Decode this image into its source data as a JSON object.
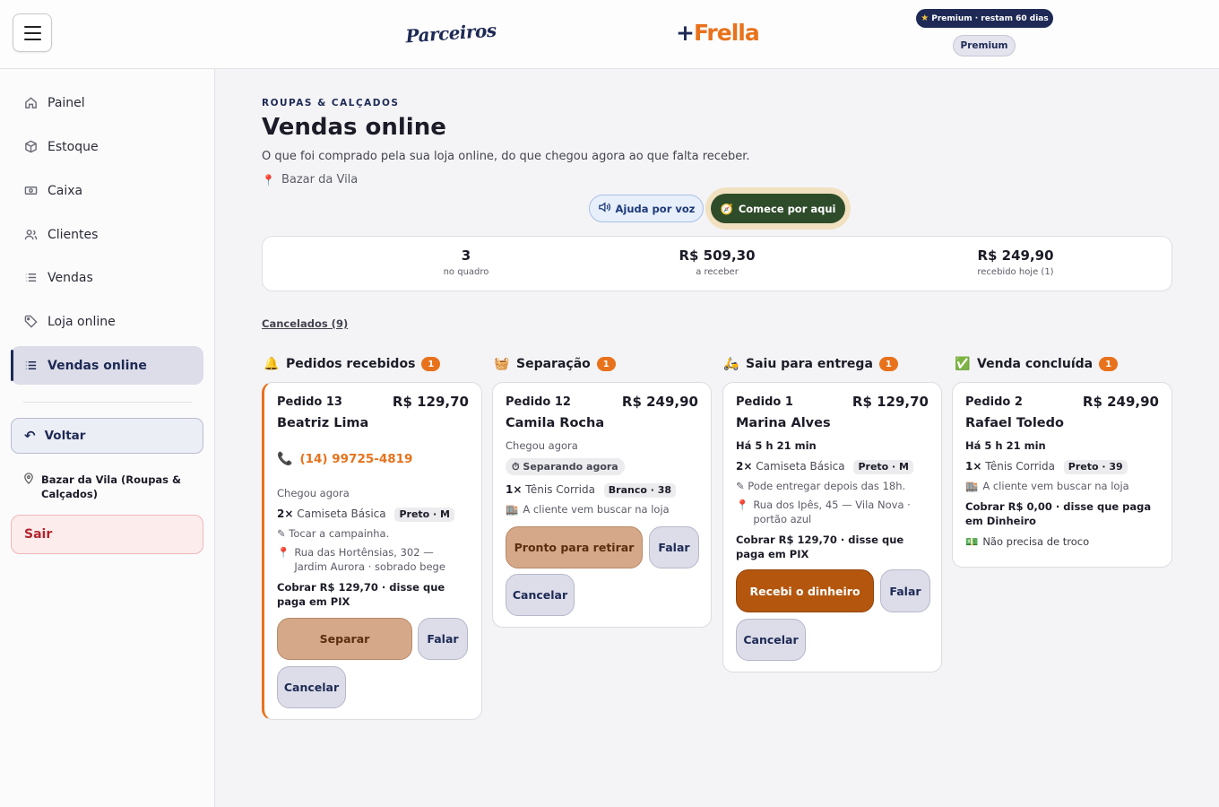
{
  "header": {
    "logo_parceiros": "Parceiros",
    "logo_frella_plus": "+",
    "logo_frella_name": "Frella",
    "premium_pill": "Premium · restam 60 dias",
    "premium_badge": "Premium"
  },
  "sidebar": {
    "items": [
      {
        "label": "Painel",
        "icon": "home-icon"
      },
      {
        "label": "Estoque",
        "icon": "box-icon"
      },
      {
        "label": "Caixa",
        "icon": "cash-icon"
      },
      {
        "label": "Clientes",
        "icon": "users-icon"
      },
      {
        "label": "Vendas",
        "icon": "list-icon"
      },
      {
        "label": "Loja online",
        "icon": "tag-icon"
      },
      {
        "label": "Vendas online",
        "icon": "list-icon",
        "active": true
      }
    ],
    "back_label": "Voltar",
    "store_label": "Bazar da Vila (Roupas & Calçados)",
    "logout_label": "Sair"
  },
  "page": {
    "eyebrow": "ROUPAS & CALÇADOS",
    "title": "Vendas online",
    "subtitle": "O que foi comprado pela sua loja online, do que chegou agora ao que falta receber.",
    "store": "Bazar da Vila",
    "voice_help_label": "Ajuda por voz",
    "start_here_label": "Comece por aqui",
    "cancelled_link": "Cancelados (9)"
  },
  "stats": [
    {
      "value": "3",
      "label": "no quadro"
    },
    {
      "value": "R$ 509,30",
      "label": "a receber"
    },
    {
      "value": "R$ 249,90",
      "label": "recebido hoje (1)"
    }
  ],
  "columns": [
    {
      "title": "Pedidos recebidos",
      "emoji": "🔔",
      "count": "1",
      "card": {
        "id": "Pedido 13",
        "price": "R$ 129,70",
        "name": "Beatriz Lima",
        "phone": "(14) 99725-4819",
        "arrived": "Chegou agora",
        "qty": "2×",
        "item": "Camiseta Básica",
        "tag": "Preto · M",
        "note": "✎ Tocar a campainha.",
        "address": "Rua das Hortênsias, 302 — Jardim Aurora · sobrado bege",
        "charge": "Cobrar R$ 129,70 · disse que paga em PIX",
        "btn_primary": "Separar",
        "btn_talk": "Falar",
        "btn_cancel": "Cancelar"
      }
    },
    {
      "title": "Separação",
      "emoji": "🧺",
      "count": "1",
      "card": {
        "id": "Pedido 12",
        "price": "R$ 249,90",
        "name": "Camila Rocha",
        "arrived": "Chegou agora",
        "status": "⏱ Separando agora",
        "qty": "1×",
        "item": "Tênis Corrida",
        "tag": "Branco · 38",
        "pickup": "A cliente vem buscar na loja",
        "btn_primary": "Pronto para retirar",
        "btn_talk": "Falar",
        "btn_cancel": "Cancelar"
      }
    },
    {
      "title": "Saiu para entrega",
      "emoji": "🛵",
      "count": "1",
      "card": {
        "id": "Pedido 1",
        "price": "R$ 129,70",
        "name": "Marina Alves",
        "since": "Há 5 h 21 min",
        "qty": "2×",
        "item": "Camiseta Básica",
        "tag": "Preto · M",
        "note": "✎ Pode entregar depois das 18h.",
        "address": "Rua dos Ipês, 45 — Vila Nova · portão azul",
        "charge": "Cobrar R$ 129,70 · disse que paga em PIX",
        "btn_primary": "Recebi o dinheiro",
        "btn_talk": "Falar",
        "btn_cancel": "Cancelar"
      }
    },
    {
      "title": "Venda concluída",
      "emoji": "✅",
      "count": "1",
      "card": {
        "id": "Pedido 2",
        "price": "R$ 249,90",
        "name": "Rafael Toledo",
        "since": "Há 5 h 21 min",
        "qty": "1×",
        "item": "Tênis Corrida",
        "tag": "Preto · 39",
        "pickup": "A cliente vem buscar na loja",
        "charge": "Cobrar R$ 0,00 · disse que paga em Dinheiro",
        "change": "Não precisa de troco"
      }
    }
  ],
  "colors": {
    "brand_navy": "#1e2a55",
    "accent_orange": "#e8721c",
    "start_green": "#2f4c2a",
    "danger": "#b3262e"
  }
}
